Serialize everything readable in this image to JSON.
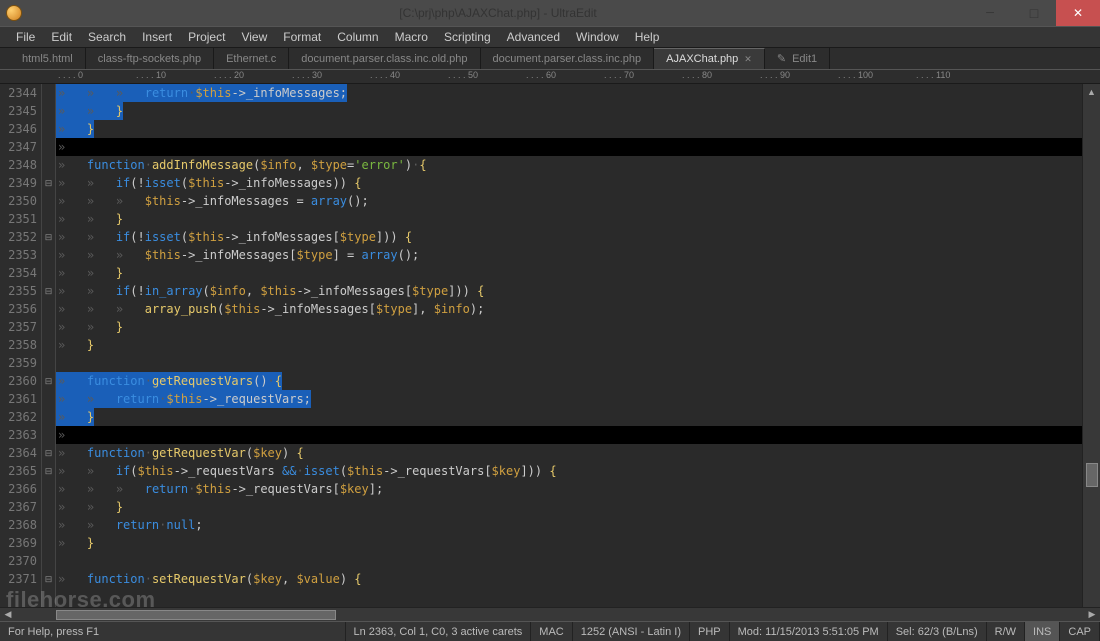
{
  "title": "[C:\\prj\\php\\AJAXChat.php] - UltraEdit",
  "menu": [
    "File",
    "Edit",
    "Search",
    "Insert",
    "Project",
    "View",
    "Format",
    "Column",
    "Macro",
    "Scripting",
    "Advanced",
    "Window",
    "Help"
  ],
  "tabs": [
    {
      "label": "html5.html",
      "active": false
    },
    {
      "label": "class-ftp-sockets.php",
      "active": false
    },
    {
      "label": "Ethernet.c",
      "active": false
    },
    {
      "label": "document.parser.class.inc.old.php",
      "active": false
    },
    {
      "label": "document.parser.class.inc.php",
      "active": false
    },
    {
      "label": "AJAXChat.php",
      "active": true
    },
    {
      "label": "Edit1",
      "active": false,
      "icon": "pencil"
    }
  ],
  "ruler_marks": [
    "0",
    "10",
    "20",
    "30",
    "40",
    "50",
    "60",
    "70",
    "80",
    "90",
    "100",
    "110"
  ],
  "lines": [
    {
      "n": 2344,
      "sel": true,
      "fold": "",
      "html": "<span class='tabchar'>»   </span><span class='tabchar'>»   </span><span class='tabchar'>»   </span><span class='hl-kw'>return</span><span class='tabchar'>·</span><span class='hl-var'>$this</span><span class='hl-op'>-&gt;</span><span class='hl-op'>_infoMessages;</span>"
    },
    {
      "n": 2345,
      "sel": true,
      "fold": "",
      "html": "<span class='tabchar'>»   </span><span class='tabchar'>»   </span><span class='hl-br'>}</span>"
    },
    {
      "n": 2346,
      "sel": true,
      "fold": "",
      "html": "<span class='tabchar'>»   </span><span class='hl-br'>}</span>"
    },
    {
      "n": 2347,
      "caret": true,
      "fold": "",
      "html": "<span class='tabchar'>»</span>"
    },
    {
      "n": 2348,
      "fold": "",
      "html": "<span class='tabchar'>»   </span><span class='hl-kw'>function</span><span class='tabchar'>·</span><span class='hl-fn'>addInfoMessage</span><span class='hl-op'>(</span><span class='hl-var'>$info</span><span class='hl-op'>, </span><span class='hl-var'>$type</span><span class='hl-op'>=</span><span class='hl-str'>'error'</span><span class='hl-op'>)</span><span class='tabchar'>·</span><span class='hl-br'>{</span>"
    },
    {
      "n": 2349,
      "fold": "box",
      "html": "<span class='tabchar'>»   </span><span class='tabchar'>»   </span><span class='hl-kw'>if</span><span class='hl-op'>(!</span><span class='hl-kw'>isset</span><span class='hl-op'>(</span><span class='hl-var'>$this</span><span class='hl-op'>-&gt;_infoMessages)) </span><span class='hl-br'>{</span>"
    },
    {
      "n": 2350,
      "fold": "",
      "html": "<span class='tabchar'>»   </span><span class='tabchar'>»   </span><span class='tabchar'>»   </span><span class='hl-var'>$this</span><span class='hl-op'>-&gt;_infoMessages = </span><span class='hl-kw'>array</span><span class='hl-op'>();</span>"
    },
    {
      "n": 2351,
      "fold": "",
      "html": "<span class='tabchar'>»   </span><span class='tabchar'>»   </span><span class='hl-br'>}</span>"
    },
    {
      "n": 2352,
      "fold": "box",
      "html": "<span class='tabchar'>»   </span><span class='tabchar'>»   </span><span class='hl-kw'>if</span><span class='hl-op'>(!</span><span class='hl-kw'>isset</span><span class='hl-op'>(</span><span class='hl-var'>$this</span><span class='hl-op'>-&gt;_infoMessages[</span><span class='hl-var'>$type</span><span class='hl-op'>])) </span><span class='hl-br'>{</span>"
    },
    {
      "n": 2353,
      "fold": "",
      "html": "<span class='tabchar'>»   </span><span class='tabchar'>»   </span><span class='tabchar'>»   </span><span class='hl-var'>$this</span><span class='hl-op'>-&gt;_infoMessages[</span><span class='hl-var'>$type</span><span class='hl-op'>] = </span><span class='hl-kw'>array</span><span class='hl-op'>();</span>"
    },
    {
      "n": 2354,
      "fold": "",
      "html": "<span class='tabchar'>»   </span><span class='tabchar'>»   </span><span class='hl-br'>}</span>"
    },
    {
      "n": 2355,
      "fold": "box",
      "html": "<span class='tabchar'>»   </span><span class='tabchar'>»   </span><span class='hl-kw'>if</span><span class='hl-op'>(!</span><span class='hl-kw'>in_array</span><span class='hl-op'>(</span><span class='hl-var'>$info</span><span class='hl-op'>, </span><span class='hl-var'>$this</span><span class='hl-op'>-&gt;_infoMessages[</span><span class='hl-var'>$type</span><span class='hl-op'>])) </span><span class='hl-br'>{</span>"
    },
    {
      "n": 2356,
      "fold": "",
      "html": "<span class='tabchar'>»   </span><span class='tabchar'>»   </span><span class='tabchar'>»   </span><span class='hl-fn'>array_push</span><span class='hl-op'>(</span><span class='hl-var'>$this</span><span class='hl-op'>-&gt;_infoMessages[</span><span class='hl-var'>$type</span><span class='hl-op'>], </span><span class='hl-var'>$info</span><span class='hl-op'>);</span>"
    },
    {
      "n": 2357,
      "fold": "",
      "html": "<span class='tabchar'>»   </span><span class='tabchar'>»   </span><span class='hl-br'>}</span>"
    },
    {
      "n": 2358,
      "fold": "",
      "html": "<span class='tabchar'>»   </span><span class='hl-br'>}</span>"
    },
    {
      "n": 2359,
      "fold": "",
      "html": ""
    },
    {
      "n": 2360,
      "sel": true,
      "fold": "box",
      "html": "<span class='tabchar'>»   </span><span class='hl-kw'>function</span><span class='tabchar'>·</span><span class='hl-fn'>getRequestVars</span><span class='hl-op'>()</span><span class='tabchar'>·</span><span class='hl-br'>{</span>"
    },
    {
      "n": 2361,
      "sel": true,
      "fold": "",
      "html": "<span class='tabchar'>»   </span><span class='tabchar'>»   </span><span class='hl-kw'>return</span><span class='tabchar'>·</span><span class='hl-var'>$this</span><span class='hl-op'>-&gt;_requestVars;</span>"
    },
    {
      "n": 2362,
      "sel": true,
      "fold": "",
      "html": "<span class='tabchar'>»   </span><span class='hl-br'>}</span>"
    },
    {
      "n": 2363,
      "caret": true,
      "fold": "",
      "html": "<span class='tabchar'>»</span>"
    },
    {
      "n": 2364,
      "fold": "box",
      "html": "<span class='tabchar'>»   </span><span class='hl-kw'>function</span><span class='tabchar'>·</span><span class='hl-fn'>getRequestVar</span><span class='hl-op'>(</span><span class='hl-var'>$key</span><span class='hl-op'>) </span><span class='hl-br'>{</span>"
    },
    {
      "n": 2365,
      "fold": "box",
      "html": "<span class='tabchar'>»   </span><span class='tabchar'>»   </span><span class='hl-kw'>if</span><span class='hl-op'>(</span><span class='hl-var'>$this</span><span class='hl-op'>-&gt;_requestVars </span><span class='hl-kw'>&amp;&amp;</span><span class='tabchar'>·</span><span class='hl-kw'>isset</span><span class='hl-op'>(</span><span class='hl-var'>$this</span><span class='hl-op'>-&gt;_requestVars[</span><span class='hl-var'>$key</span><span class='hl-op'>])) </span><span class='hl-br'>{</span>"
    },
    {
      "n": 2366,
      "fold": "",
      "html": "<span class='tabchar'>»   </span><span class='tabchar'>»   </span><span class='tabchar'>»   </span><span class='hl-kw'>return</span><span class='tabchar'>·</span><span class='hl-var'>$this</span><span class='hl-op'>-&gt;_requestVars[</span><span class='hl-var'>$key</span><span class='hl-op'>];</span>"
    },
    {
      "n": 2367,
      "fold": "",
      "html": "<span class='tabchar'>»   </span><span class='tabchar'>»   </span><span class='hl-br'>}</span>"
    },
    {
      "n": 2368,
      "fold": "",
      "html": "<span class='tabchar'>»   </span><span class='tabchar'>»   </span><span class='hl-kw'>return</span><span class='tabchar'>·</span><span class='hl-null'>null</span><span class='hl-op'>;</span>"
    },
    {
      "n": 2369,
      "fold": "",
      "html": "<span class='tabchar'>»   </span><span class='hl-br'>}</span>"
    },
    {
      "n": 2370,
      "fold": "",
      "html": ""
    },
    {
      "n": 2371,
      "fold": "box",
      "html": "<span class='tabchar'>»   </span><span class='hl-kw'>function</span><span class='tabchar'>·</span><span class='hl-fn'>setRequestVar</span><span class='hl-op'>(</span><span class='hl-var'>$key</span><span class='hl-op'>, </span><span class='hl-var'>$value</span><span class='hl-op'>) </span><span class='hl-br'>{</span>"
    }
  ],
  "status": {
    "help": "For Help, press F1",
    "pos": "Ln 2363, Col 1, C0, 3 active carets",
    "ending": "MAC",
    "encoding": "1252 (ANSI - Latin I)",
    "lang": "PHP",
    "mod": "Mod: 11/15/2013 5:51:05 PM",
    "sel": "Sel: 62/3 (B/Lns)",
    "rw": "R/W",
    "ins": "INS",
    "cap": "CAP"
  },
  "watermark": "filehorse.com"
}
